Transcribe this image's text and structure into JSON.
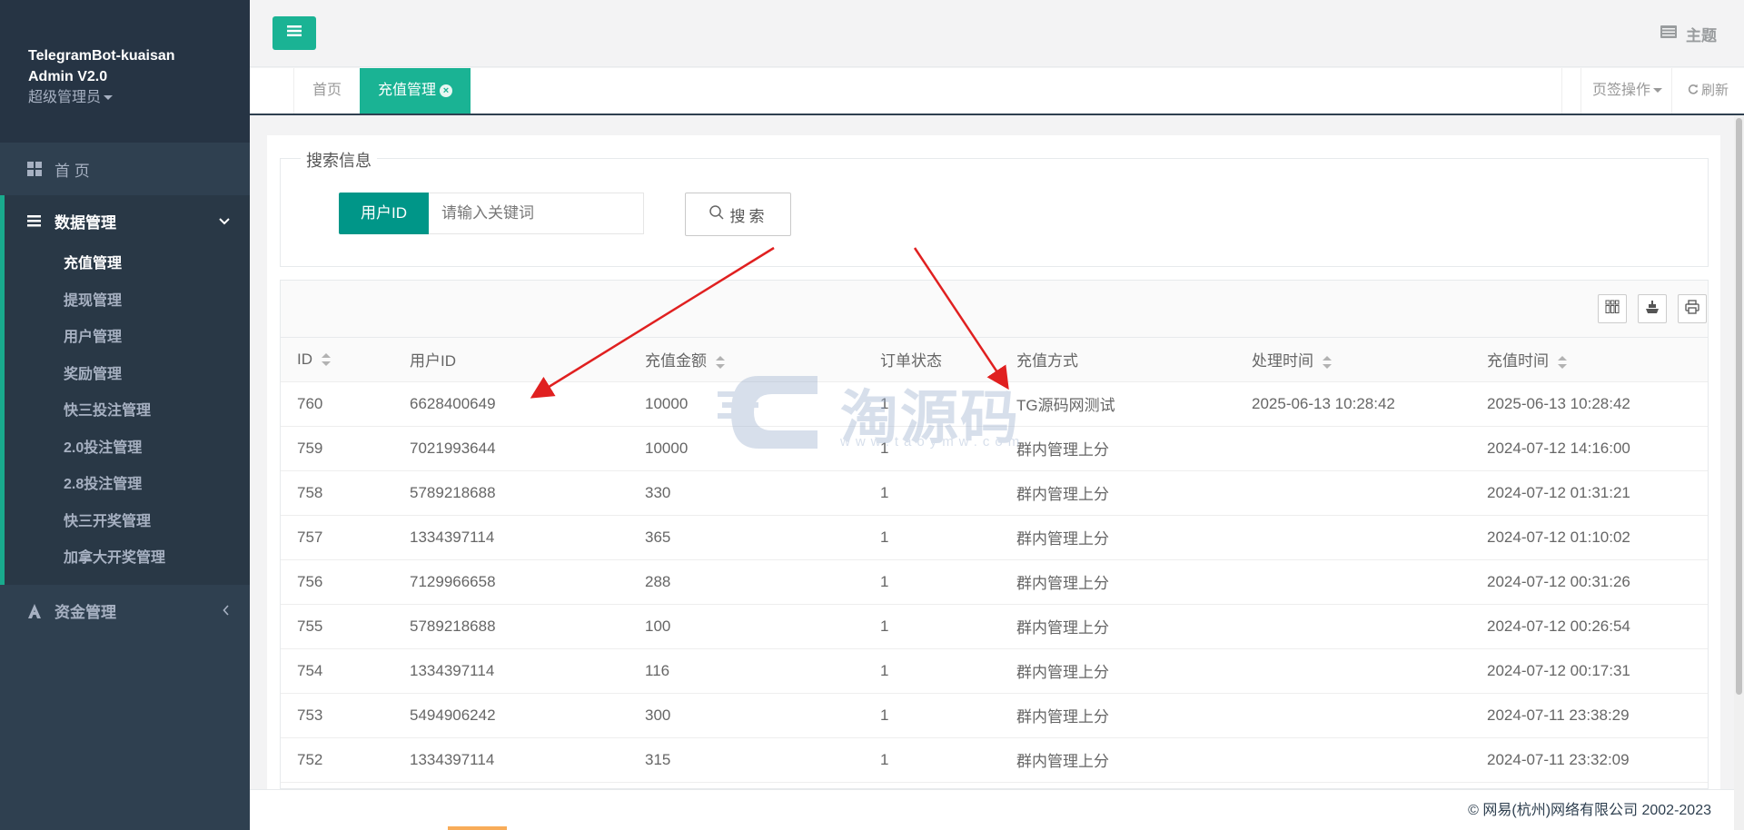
{
  "sidebar": {
    "title_line1": "TelegramBot-kuaisan",
    "title_line2": "Admin V2.0",
    "role": "超级管理员",
    "home": "首 页",
    "group_label": "数据管理",
    "sub_items": [
      "充值管理",
      "提现管理",
      "用户管理",
      "奖励管理",
      "快三投注管理",
      "2.0投注管理",
      "2.8投注管理",
      "快三开奖管理",
      "加拿大开奖管理"
    ],
    "money": "资金管理"
  },
  "topbar": {
    "theme": "主题"
  },
  "tabs": {
    "home": "首页",
    "active": "充值管理",
    "ops": "页签操作",
    "refresh": "刷新"
  },
  "search": {
    "legend": "搜索信息",
    "field_label": "用户ID",
    "placeholder": "请输入关键词",
    "button": "搜索"
  },
  "table": {
    "columns": [
      "ID",
      "用户ID",
      "充值金额",
      "订单状态",
      "充值方式",
      "处理时间",
      "充值时间"
    ],
    "sortable": [
      true,
      false,
      true,
      false,
      false,
      true,
      true
    ],
    "rows": [
      [
        "760",
        "6628400649",
        "10000",
        "1",
        "TG源码网测试",
        "2025-06-13 10:28:42",
        "2025-06-13 10:28:42"
      ],
      [
        "759",
        "7021993644",
        "10000",
        "1",
        "群内管理上分",
        "",
        "2024-07-12 14:16:00"
      ],
      [
        "758",
        "5789218688",
        "330",
        "1",
        "群内管理上分",
        "",
        "2024-07-12 01:31:21"
      ],
      [
        "757",
        "1334397114",
        "365",
        "1",
        "群内管理上分",
        "",
        "2024-07-12 01:10:02"
      ],
      [
        "756",
        "7129966658",
        "288",
        "1",
        "群内管理上分",
        "",
        "2024-07-12 00:31:26"
      ],
      [
        "755",
        "5789218688",
        "100",
        "1",
        "群内管理上分",
        "",
        "2024-07-12 00:26:54"
      ],
      [
        "754",
        "1334397114",
        "116",
        "1",
        "群内管理上分",
        "",
        "2024-07-12 00:17:31"
      ],
      [
        "753",
        "5494906242",
        "300",
        "1",
        "群内管理上分",
        "",
        "2024-07-11 23:38:29"
      ],
      [
        "752",
        "1334397114",
        "315",
        "1",
        "群内管理上分",
        "",
        "2024-07-11 23:32:09"
      ]
    ]
  },
  "watermark": {
    "text": "淘源码",
    "sub": "www.taoymw.com"
  },
  "footer": "© 网易(杭州)网络有限公司 2002-2023",
  "colors": {
    "sidebar": "#2f4050",
    "accent": "#1ab394",
    "search_label": "#009688",
    "arrow": "#e02020"
  },
  "icons": [
    "menu-icon",
    "theme-icon",
    "dashboard-icon",
    "list-icon",
    "chevron-down-icon",
    "money-icon",
    "chevron-left-icon",
    "close-icon",
    "search-icon",
    "columns-icon",
    "export-icon",
    "print-icon",
    "refresh-icon"
  ]
}
